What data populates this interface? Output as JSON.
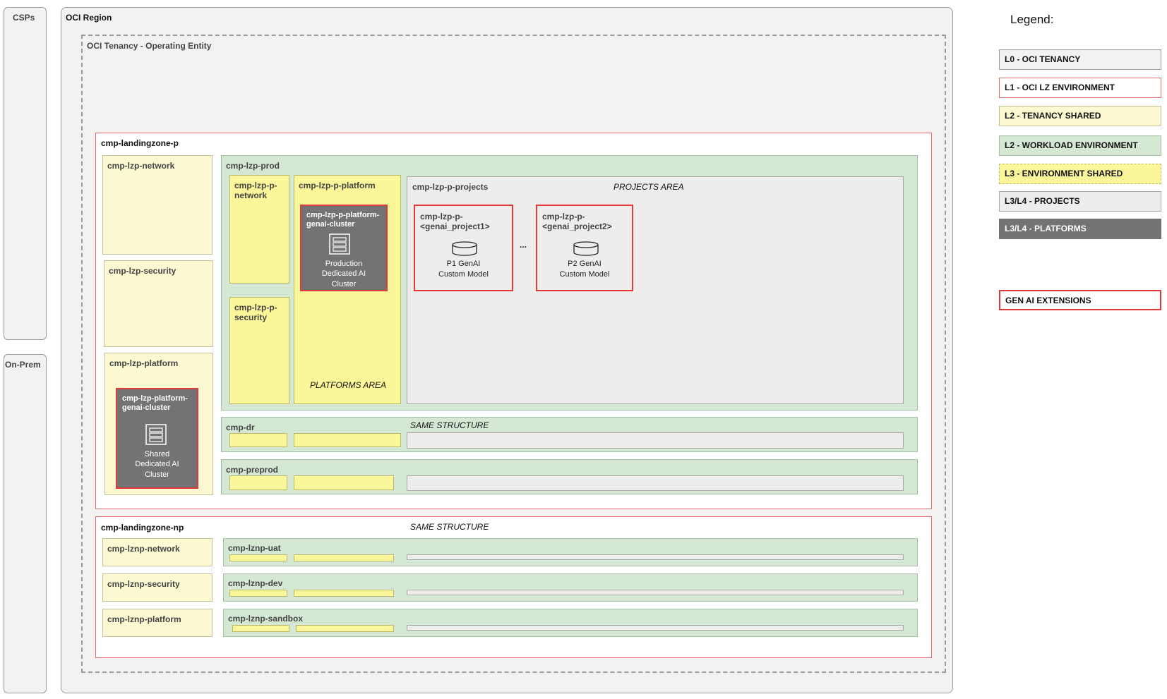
{
  "sides": {
    "csps": "CSPs",
    "on_prem": "On-Prem"
  },
  "region": {
    "title": "OCI Region"
  },
  "tenancy": {
    "title": "OCI Tenancy - Operating Entity"
  },
  "lz_prod": {
    "title": "cmp-landingzone-p",
    "network": "cmp-lzp-network",
    "security": "cmp-lzp-security",
    "platform": "cmp-lzp-platform",
    "shared_cluster": {
      "title": "cmp-lzp-platform-genai-cluster",
      "line1": "Shared",
      "line2": "Dedicated AI",
      "line3": "Cluster"
    },
    "prod": {
      "title": "cmp-lzp-prod",
      "network": "cmp-lzp-p-network",
      "security": "cmp-lzp-p-security",
      "platform": "cmp-lzp-p-platform",
      "platforms_area": "PLATFORMS AREA",
      "cluster": {
        "title": "cmp-lzp-p-platform-genai-cluster",
        "line1": "Production",
        "line2": "Dedicated AI",
        "line3": "Cluster"
      },
      "projects": "cmp-lzp-p-projects",
      "projects_area": "PROJECTS AREA",
      "project1": {
        "title1": "cmp-lzp-p-",
        "title2": "<genai_project1>",
        "line1": "P1 GenAI",
        "line2": "Custom Model"
      },
      "ellipsis": "...",
      "project2": {
        "title1": "cmp-lzp-p-",
        "title2": "<genai_project2>",
        "line1": "P2 GenAI",
        "line2": "Custom Model"
      }
    },
    "dr": "cmp-dr",
    "same_structure": "SAME STRUCTURE",
    "preprod": "cmp-preprod"
  },
  "lz_np": {
    "title": "cmp-landingzone-np",
    "same_structure": "SAME STRUCTURE",
    "network": "cmp-lznp-network",
    "security": "cmp-lznp-security",
    "platform": "cmp-lznp-platform",
    "uat": "cmp-lznp-uat",
    "dev": "cmp-lznp-dev",
    "sandbox": "cmp-lznp-sandbox"
  },
  "legend": {
    "title": "Legend:",
    "items": [
      {
        "label": "L0 - OCI TENANCY",
        "fill": "#f3f2f0",
        "stroke": "#9d9d9d",
        "text": "#111111"
      },
      {
        "label": "L1 - OCI LZ ENVIRONMENT",
        "fill": "#ffffff",
        "stroke": "#e36a6a",
        "text": "#111111"
      },
      {
        "label": "L2 - TENANCY SHARED",
        "fill": "#fbf8d2",
        "stroke": "#c3c09a",
        "text": "#111111"
      },
      {
        "label": "L2 - WORKLOAD ENVIRONMENT",
        "fill": "#d5e8d4",
        "stroke": "#a6bea5",
        "text": "#111111"
      },
      {
        "label": "L3 - ENVIRONMENT SHARED",
        "fill": "#fbf69a",
        "stroke": "#bdb76c",
        "text": "#111111"
      },
      {
        "label": "L3/L4 - PROJECTS",
        "fill": "#efedeb",
        "stroke": "#a8a8a8",
        "text": "#111111"
      },
      {
        "label": "L3/L4 - PLATFORMS",
        "fill": "#737373",
        "stroke": "#737373",
        "text": "#ffffff"
      }
    ],
    "genai": {
      "label": "GEN AI EXTENSIONS",
      "fill": "#ffffff",
      "stroke": "#e2383a",
      "text": "#111111"
    }
  }
}
